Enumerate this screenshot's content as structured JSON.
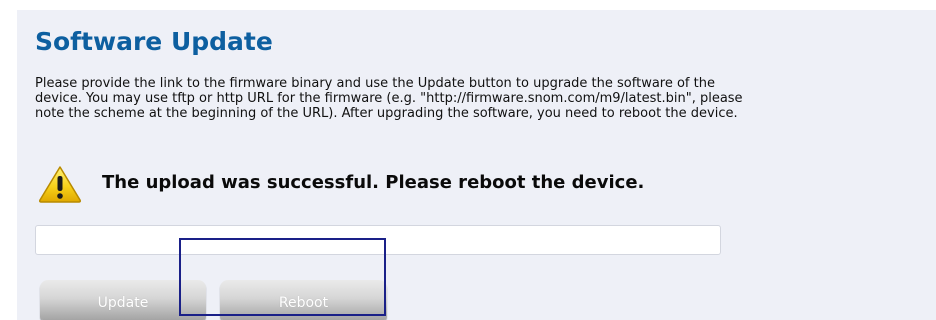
{
  "page": {
    "title": "Software Update",
    "description_lines": [
      "Please provide the link to the firmware binary and use the Update button to upgrade the software of the",
      "device. You may use tftp or http URL for the firmware (e.g. \"http://firmware.snom.com/m9/latest.bin\", please",
      "note the scheme at the beginning of the URL). After upgrading the software, you need to reboot the device."
    ],
    "status_message": "The upload was successful. Please reboot the device."
  },
  "form": {
    "url_value": "",
    "update_label": "Update",
    "reboot_label": "Reboot"
  },
  "icons": {
    "status_icon": "warning-icon"
  },
  "colors": {
    "title": "#0d5fa0",
    "panel_background": "#eef0f7",
    "warning_fill": "#f5c400",
    "focus_outline": "#1a2088",
    "button_text": "#ffffff"
  }
}
